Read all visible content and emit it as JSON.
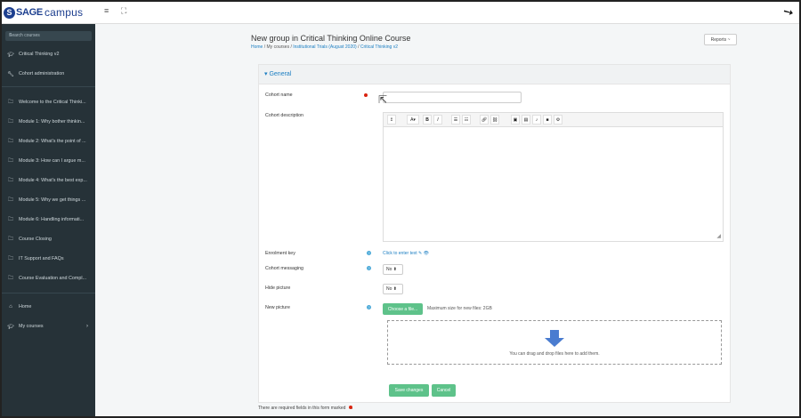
{
  "topbar": {
    "logo_mark": "S",
    "logo_sage": "SAGE",
    "logo_campus": "campus",
    "menu_icon": "hamburger-icon",
    "fullscreen_icon": "expand-icon"
  },
  "sidebar": {
    "search_placeholder": "Search courses",
    "items": [
      {
        "label": "Critical Thinking v2",
        "icon": "graduation-cap-icon"
      },
      {
        "label": "Cohort administration",
        "icon": "wrench-icon"
      },
      {
        "label": "Welcome to the Critical Thinki...",
        "icon": "folder-icon"
      },
      {
        "label": "Module 1: Why bother thinkin...",
        "icon": "folder-icon"
      },
      {
        "label": "Module 2: What's the point of ...",
        "icon": "folder-icon"
      },
      {
        "label": "Module 3: How can I argue m...",
        "icon": "folder-icon"
      },
      {
        "label": "Module 4: What's the best exp...",
        "icon": "folder-icon"
      },
      {
        "label": "Module 5: Why we get things ...",
        "icon": "folder-icon"
      },
      {
        "label": "Module 6: Handling informati...",
        "icon": "folder-icon"
      },
      {
        "label": "Course Closing",
        "icon": "folder-icon"
      },
      {
        "label": "IT Support and FAQs",
        "icon": "folder-icon"
      },
      {
        "label": "Course Evaluation and Compl...",
        "icon": "folder-icon"
      },
      {
        "label": "Home",
        "icon": "home-icon"
      },
      {
        "label": "My courses",
        "icon": "graduation-cap-icon"
      }
    ]
  },
  "header": {
    "title": "New group in Critical Thinking Online Course",
    "breadcrumb": [
      "Home",
      "My courses",
      "Institutional Trials (August 2020)",
      "Critical Thinking v2"
    ],
    "reports_label": "Reports ~"
  },
  "form": {
    "section_title": "General",
    "cohort_name_label": "Cohort name",
    "cohort_name_value": "",
    "cohort_description_label": "Cohort description",
    "enrolment_key_label": "Enrolment key",
    "enrolment_key_link": "Click to enter text",
    "cohort_messaging_label": "Cohort messaging",
    "cohort_messaging_value": "No",
    "hide_picture_label": "Hide picture",
    "hide_picture_value": "No",
    "new_picture_label": "New picture",
    "choose_file_label": "Choose a file...",
    "max_size_text": "Maximum size for new files: 2GB",
    "dropzone_text": "You can drag and drop files here to add them.",
    "save_label": "Save changes",
    "cancel_label": "Cancel",
    "required_note": "There are required fields in this form marked"
  },
  "colors": {
    "sidebar_bg": "#263238",
    "accent_blue": "#1b7ec2",
    "button_green": "#5ec28a",
    "required_red": "#d9230f"
  }
}
